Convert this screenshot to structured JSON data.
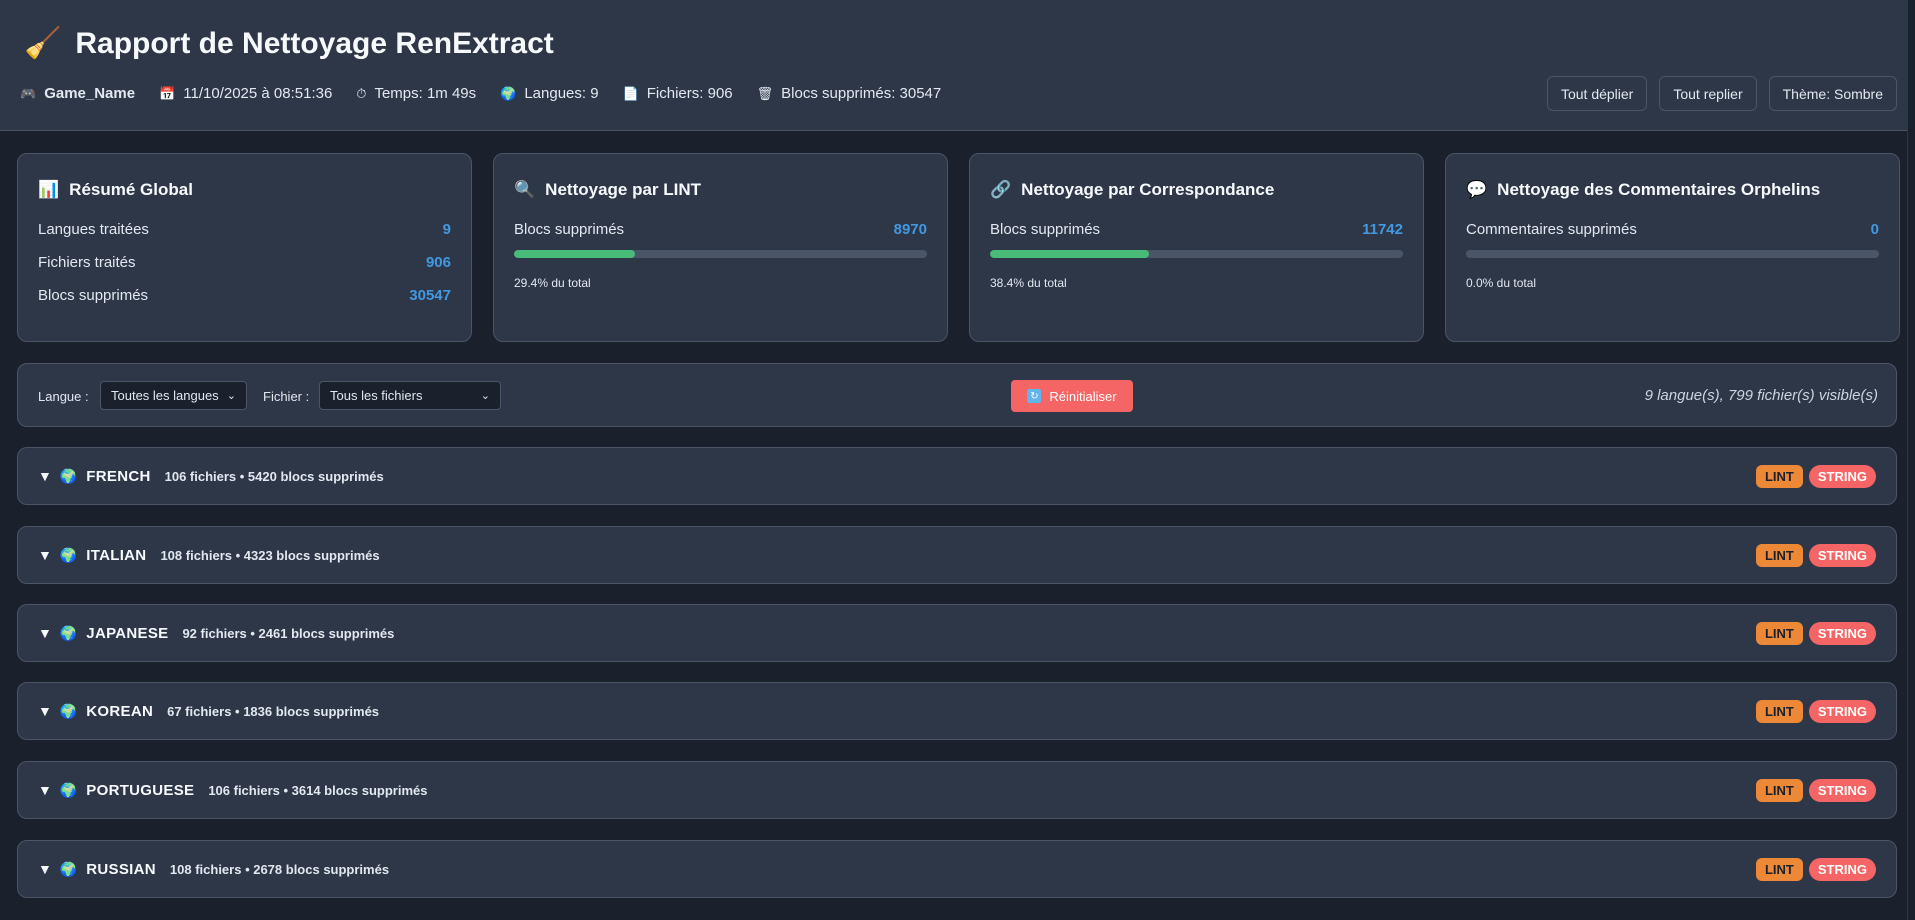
{
  "header": {
    "title": "Rapport de Nettoyage RenExtract",
    "game_name": "Game_Name",
    "date": "11/10/2025 à 08:51:36",
    "time": "Temps: 1m 49s",
    "languages": "Langues: 9",
    "files": "Fichiers: 906",
    "blocks": "Blocs supprimés: 30547",
    "buttons": {
      "expand_all": "Tout déplier",
      "collapse_all": "Tout replier",
      "theme": "Thème: Sombre"
    }
  },
  "cards": {
    "global": {
      "title": "Résumé Global",
      "rows": [
        {
          "label": "Langues traitées",
          "value": "9"
        },
        {
          "label": "Fichiers traités",
          "value": "906"
        },
        {
          "label": "Blocs supprimés",
          "value": "30547"
        }
      ]
    },
    "lint": {
      "title": "Nettoyage par LINT",
      "label": "Blocs supprimés",
      "value": "8970",
      "progress": 29.4,
      "pct_text": "29.4% du total"
    },
    "corresp": {
      "title": "Nettoyage par Correspondance",
      "label": "Blocs supprimés",
      "value": "11742",
      "progress": 38.4,
      "pct_text": "38.4% du total"
    },
    "orphans": {
      "title": "Nettoyage des Commentaires Orphelins",
      "label": "Commentaires supprimés",
      "value": "0",
      "progress": 0,
      "pct_text": "0.0% du total"
    }
  },
  "filters": {
    "lang_label": "Langue :",
    "lang_value": "Toutes les langues",
    "file_label": "Fichier :",
    "file_value": "Tous les fichiers",
    "reset": "Réinitialiser",
    "visible": "9 langue(s), 799 fichier(s) visible(s)"
  },
  "badges": {
    "lint": "LINT",
    "string": "STRING"
  },
  "languages": [
    {
      "name": "FRENCH",
      "stats": "106 fichiers • 5420 blocs supprimés"
    },
    {
      "name": "ITALIAN",
      "stats": "108 fichiers • 4323 blocs supprimés"
    },
    {
      "name": "JAPANESE",
      "stats": "92 fichiers • 2461 blocs supprimés"
    },
    {
      "name": "KOREAN",
      "stats": "67 fichiers • 1836 blocs supprimés"
    },
    {
      "name": "PORTUGUESE",
      "stats": "106 fichiers • 3614 blocs supprimés"
    },
    {
      "name": "RUSSIAN",
      "stats": "108 fichiers • 2678 blocs supprimés"
    }
  ],
  "colors": {
    "accent": "#4299e1",
    "progress": "#48bb78",
    "lint": "#ed8936",
    "string": "#f56565"
  }
}
